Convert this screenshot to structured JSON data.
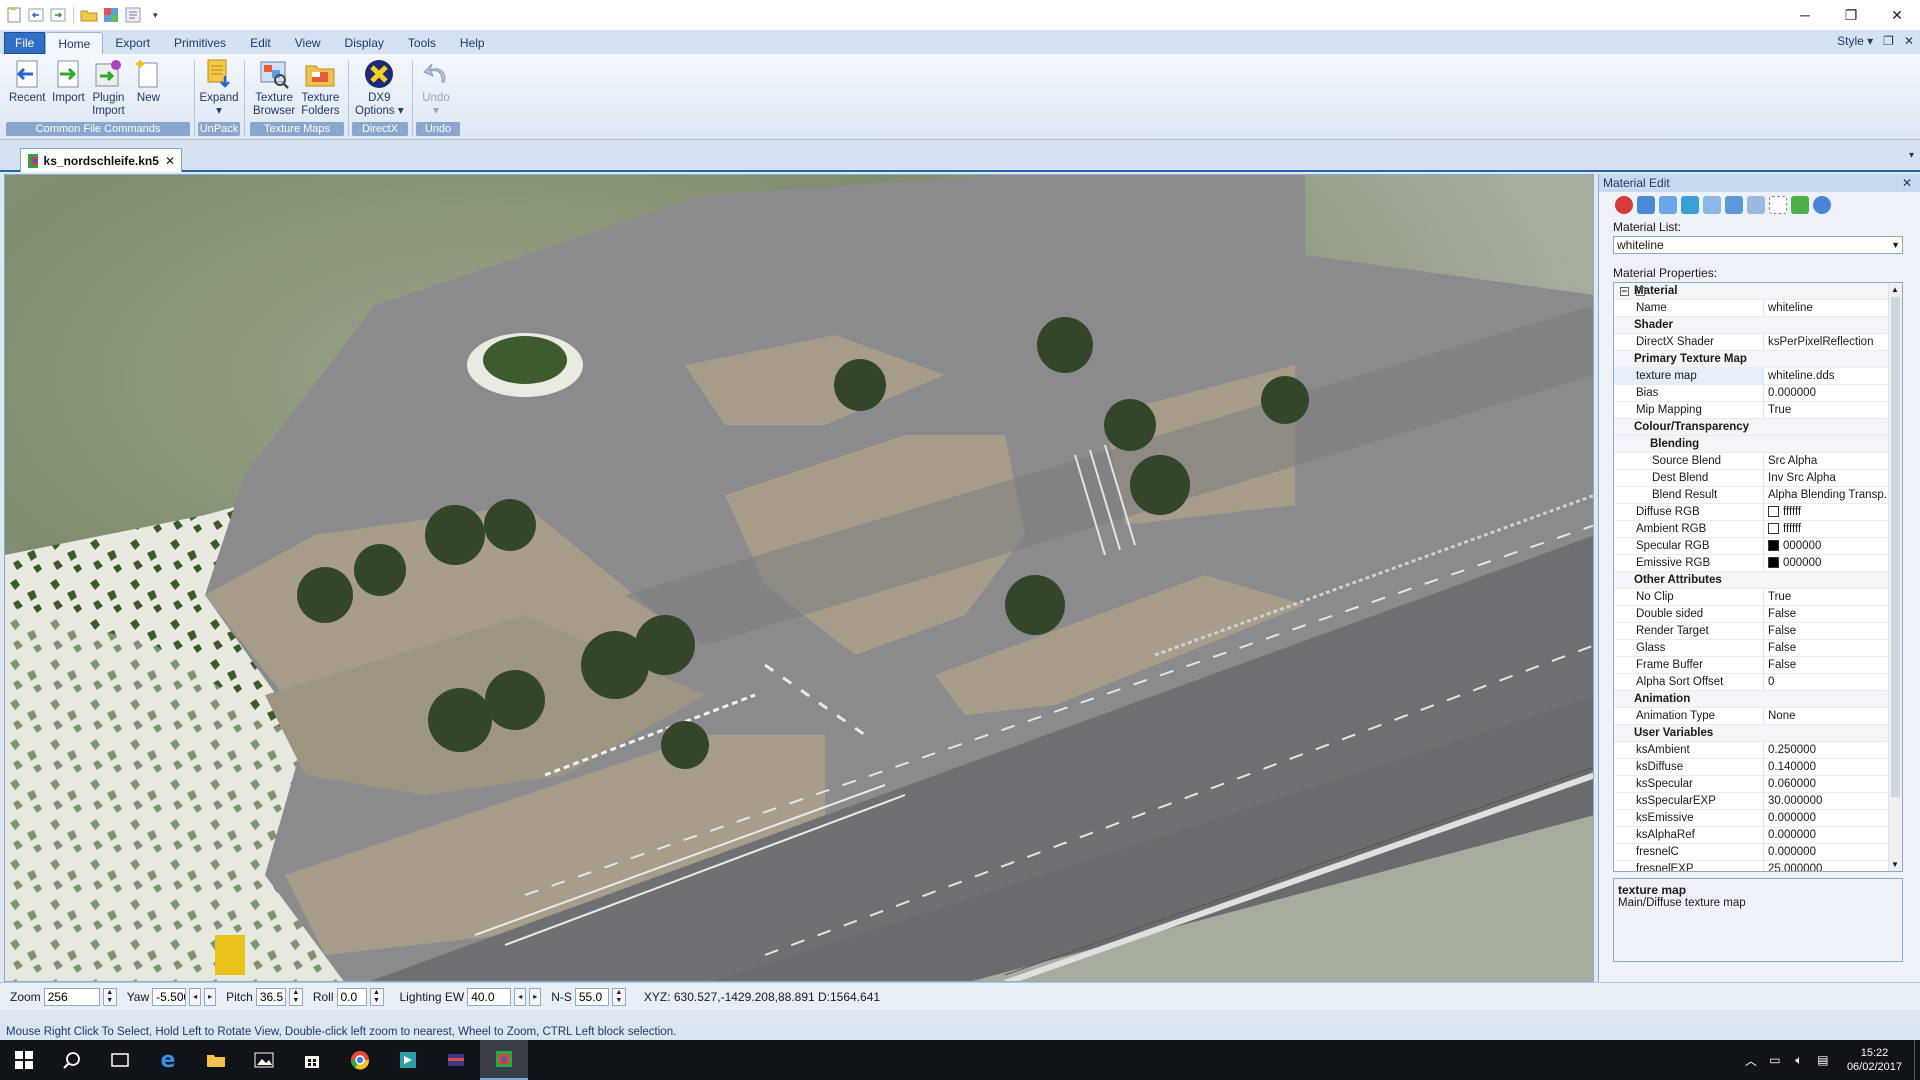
{
  "menu": {
    "tabs": [
      "File",
      "Home",
      "Export",
      "Primitives",
      "Edit",
      "View",
      "Display",
      "Tools",
      "Help"
    ],
    "style_label": "Style"
  },
  "ribbon": {
    "groups": [
      {
        "label": "Common File Commands",
        "buttons": [
          "Recent",
          "Import",
          "Plugin\nImport",
          "New"
        ]
      },
      {
        "label": "UnPack",
        "buttons": [
          "Expand"
        ]
      },
      {
        "label": "Texture Maps",
        "buttons": [
          "Texture\nBrowser",
          "Texture\nFolders"
        ]
      },
      {
        "label": "DirectX",
        "buttons": [
          "DX9\nOptions"
        ]
      },
      {
        "label": "Undo",
        "buttons": [
          "Undo"
        ]
      }
    ]
  },
  "document_tab": {
    "name": "ks_nordschleife.kn5"
  },
  "material_edit": {
    "title": "Material Edit",
    "list_label": "Material List:",
    "selected_material": "whiteline",
    "props_label": "Material Properties:",
    "rows": [
      {
        "type": "cat",
        "name": "Material"
      },
      {
        "name": "Name",
        "value": "whiteline"
      },
      {
        "type": "cat",
        "name": "Shader"
      },
      {
        "name": "DirectX Shader",
        "value": "ksPerPixelReflection"
      },
      {
        "type": "cat",
        "name": "Primary Texture Map"
      },
      {
        "name": "texture map",
        "value": "whiteline.dds",
        "selected": true,
        "ellipsis": "..."
      },
      {
        "name": "Bias",
        "value": "0.000000"
      },
      {
        "name": "Mip Mapping",
        "value": "True"
      },
      {
        "type": "cat",
        "name": "Colour/Transparency"
      },
      {
        "type": "subcat",
        "name": "Blending"
      },
      {
        "name": "Source Blend",
        "value": "Src Alpha",
        "indent": 2
      },
      {
        "name": "Dest Blend",
        "value": "Inv Src Alpha",
        "indent": 2
      },
      {
        "name": "Blend Result",
        "value": "Alpha Blending Transp...",
        "indent": 2
      },
      {
        "name": "Diffuse RGB",
        "value": "ffffff",
        "swatch": "#ffffff"
      },
      {
        "name": "Ambient RGB",
        "value": "ffffff",
        "swatch": "#ffffff"
      },
      {
        "name": "Specular RGB",
        "value": "000000",
        "swatch": "#000000"
      },
      {
        "name": "Emissive RGB",
        "value": "000000",
        "swatch": "#000000"
      },
      {
        "type": "cat",
        "name": "Other Attributes"
      },
      {
        "name": "No Clip",
        "value": "True"
      },
      {
        "name": "Double sided",
        "value": "False"
      },
      {
        "name": "Render Target",
        "value": "False"
      },
      {
        "name": "Glass",
        "value": "False"
      },
      {
        "name": "Frame Buffer",
        "value": "False"
      },
      {
        "name": "Alpha Sort Offset",
        "value": "0"
      },
      {
        "type": "cat",
        "name": "Animation"
      },
      {
        "name": "Animation Type",
        "value": "None"
      },
      {
        "type": "cat",
        "name": "User Variables"
      },
      {
        "name": "ksAmbient",
        "value": "0.250000"
      },
      {
        "name": "ksDiffuse",
        "value": "0.140000"
      },
      {
        "name": "ksSpecular",
        "value": "0.060000"
      },
      {
        "name": "ksSpecularEXP",
        "value": "30.000000"
      },
      {
        "name": "ksEmissive",
        "value": "0.000000"
      },
      {
        "name": "ksAlphaRef",
        "value": "0.000000"
      },
      {
        "name": "fresnelC",
        "value": "0.000000"
      },
      {
        "name": "fresnelEXP",
        "value": "25.000000"
      }
    ],
    "help_title": "texture map",
    "help_desc": "Main/Diffuse texture map"
  },
  "camera": {
    "zoom_label": "Zoom",
    "zoom": "256",
    "yaw_label": "Yaw",
    "yaw": "-5.500",
    "pitch_label": "Pitch",
    "pitch": "36.5",
    "roll_label": "Roll",
    "roll": "0.0",
    "lighting_label": "Lighting EW",
    "lighting": "40.0",
    "ns_label": "N-S",
    "ns": "55.0",
    "xyz": "XYZ: 630.527,-1429.208,88.891  D:1564.641"
  },
  "status": "Mouse Right Click To Select, Hold Left to Rotate View, Double-click left  zoom to nearest, Wheel to Zoom, CTRL Left block selection.",
  "taskbar": {
    "time": "15:22",
    "date": "06/02/2017"
  }
}
